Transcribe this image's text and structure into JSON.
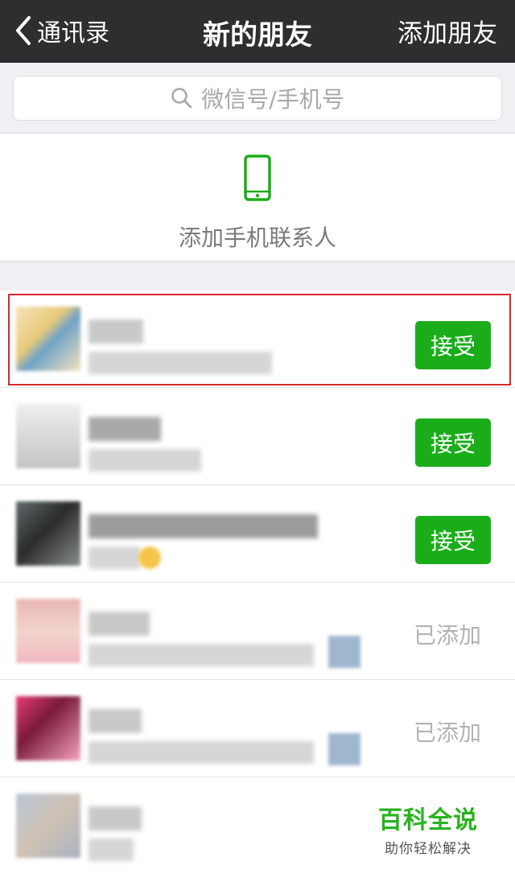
{
  "nav": {
    "back_label": "通讯录",
    "title": "新的朋友",
    "add_label": "添加朋友"
  },
  "search": {
    "placeholder": "微信号/手机号"
  },
  "phone_contacts": {
    "label": "添加手机联系人",
    "icon": "phone-icon",
    "icon_color": "#1aad19"
  },
  "requests": [
    {
      "action": "接受",
      "state": "pending"
    },
    {
      "action": "接受",
      "state": "pending"
    },
    {
      "action": "接受",
      "state": "pending"
    },
    {
      "action": "已添加",
      "state": "added"
    },
    {
      "action": "已添加",
      "state": "added"
    },
    {
      "action": "",
      "state": "unknown"
    }
  ],
  "watermark": {
    "title": "百科全说",
    "subtitle": "助你轻松解决"
  },
  "colors": {
    "nav_bg": "#2e2e30",
    "accent": "#1aad19",
    "highlight": "#d8282b"
  }
}
